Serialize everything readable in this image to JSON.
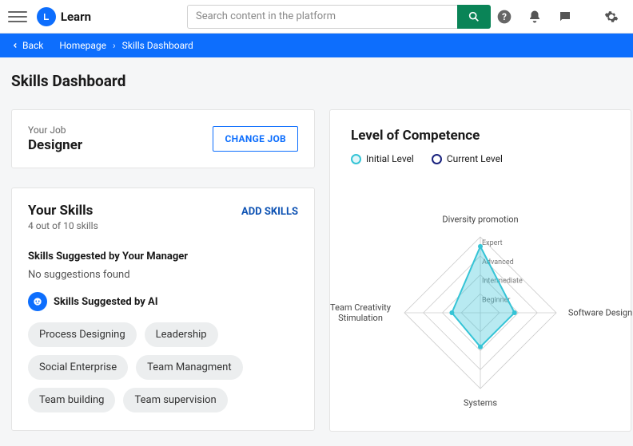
{
  "header": {
    "brand": "Learn",
    "search_placeholder": "Search content in the platform"
  },
  "breadcrumb": {
    "back": "Back",
    "homepage": "Homepage",
    "current": "Skills Dashboard"
  },
  "page_title": "Skills Dashboard",
  "job_card": {
    "label": "Your Job",
    "value": "Designer",
    "change_btn": "CHANGE JOB"
  },
  "skills_card": {
    "title": "Your Skills",
    "count_text": "4 out of 10 skills",
    "add_btn": "ADD SKILLS",
    "manager_label": "Skills Suggested by Your Manager",
    "manager_empty": "No suggestions found",
    "ai_label": "Skills Suggested by AI",
    "ai_suggestions": [
      "Process Designing",
      "Leadership",
      "Social Enterprise",
      "Team Managment",
      "Team building",
      "Team supervision"
    ]
  },
  "competence": {
    "title": "Level of Competence",
    "legend": {
      "initial": {
        "label": "Initial Level",
        "color": "#35c4d6"
      },
      "current": {
        "label": "Current Level",
        "color": "#1a237e"
      }
    },
    "rings": [
      "Beginner",
      "Intermediate",
      "Advanced",
      "Expert"
    ],
    "axes": [
      "Diversity promotion",
      "Software Design",
      "Systems",
      "Team Creativity Stimulation"
    ]
  },
  "chart_data": {
    "type": "radar",
    "title": "Level of Competence",
    "categories": [
      "Diversity promotion",
      "Software Design",
      "Systems",
      "Team Creativity Stimulation"
    ],
    "scale": {
      "levels": [
        "Beginner",
        "Intermediate",
        "Advanced",
        "Expert"
      ],
      "min": 0,
      "max": 4
    },
    "series": [
      {
        "name": "Initial Level",
        "color": "#35c4d6",
        "values": [
          3.5,
          1.8,
          1.8,
          1.5
        ]
      }
    ]
  }
}
